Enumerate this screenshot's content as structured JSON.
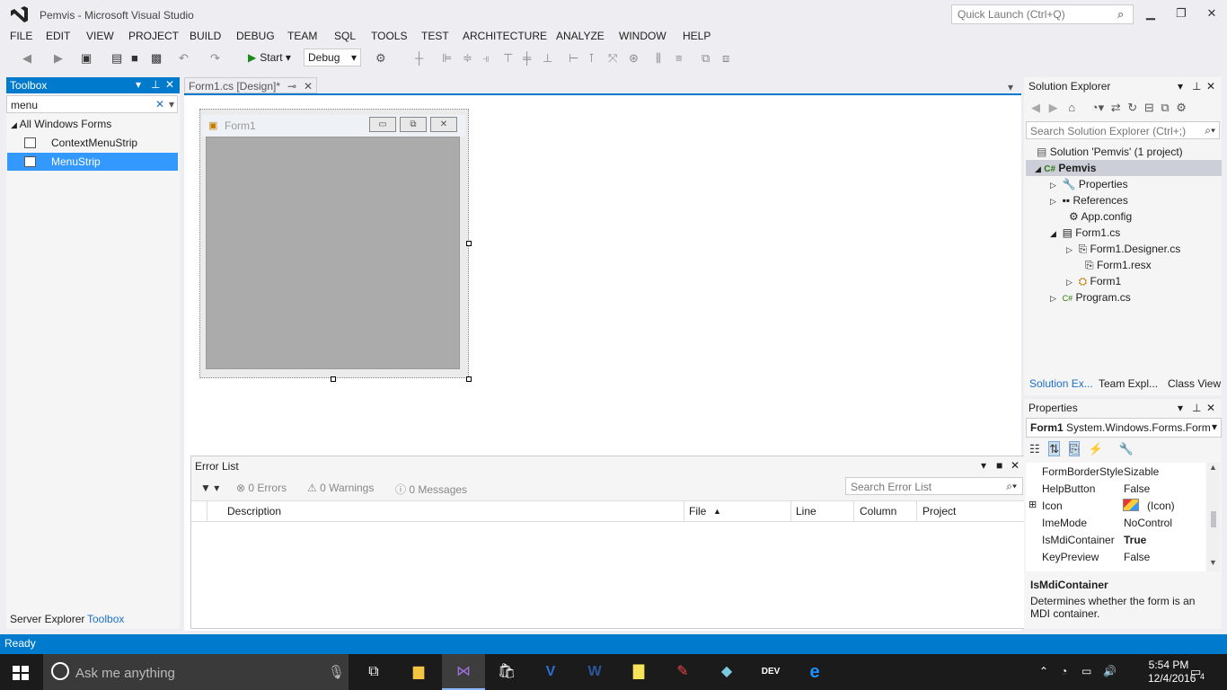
{
  "window": {
    "title": "Pemvis - Microsoft Visual Studio",
    "quick_launch_placeholder": "Quick Launch (Ctrl+Q)"
  },
  "menu": [
    "FILE",
    "EDIT",
    "VIEW",
    "PROJECT",
    "BUILD",
    "DEBUG",
    "TEAM",
    "SQL",
    "TOOLS",
    "TEST",
    "ARCHITECTURE",
    "ANALYZE",
    "WINDOW",
    "HELP"
  ],
  "toolbar": {
    "start_label": "Start",
    "config": "Debug"
  },
  "toolbox": {
    "title": "Toolbox",
    "search_value": "menu",
    "group": "All Windows Forms",
    "items": [
      "ContextMenuStrip",
      "MenuStrip"
    ],
    "tabs": [
      "Server Explorer",
      "Toolbox"
    ]
  },
  "document_tab": {
    "label": "Form1.cs [Design]*"
  },
  "form": {
    "title": "Form1"
  },
  "error_list": {
    "title": "Error List",
    "errors": "0 Errors",
    "warnings": "0 Warnings",
    "messages": "0 Messages",
    "search_placeholder": "Search Error List",
    "columns": [
      "Description",
      "File",
      "Line",
      "Column",
      "Project"
    ]
  },
  "solution_explorer": {
    "title": "Solution Explorer",
    "search_placeholder": "Search Solution Explorer (Ctrl+;)",
    "tree": [
      {
        "label": "Solution 'Pemvis' (1 project)"
      },
      {
        "label": "Pemvis"
      },
      {
        "label": "Properties"
      },
      {
        "label": "References"
      },
      {
        "label": "App.config"
      },
      {
        "label": "Form1.cs"
      },
      {
        "label": "Form1.Designer.cs"
      },
      {
        "label": "Form1.resx"
      },
      {
        "label": "Form1"
      },
      {
        "label": "Program.cs"
      }
    ],
    "tabs": [
      "Solution Ex...",
      "Team Expl...",
      "Class View"
    ]
  },
  "properties": {
    "title": "Properties",
    "object_name": "Form1",
    "object_type": "System.Windows.Forms.Form",
    "rows": [
      {
        "name": "FormBorderStyle",
        "value": "Sizable"
      },
      {
        "name": "HelpButton",
        "value": "False"
      },
      {
        "name": "Icon",
        "value": "(Icon)"
      },
      {
        "name": "ImeMode",
        "value": "NoControl"
      },
      {
        "name": "IsMdiContainer",
        "value": "True"
      },
      {
        "name": "KeyPreview",
        "value": "False"
      }
    ],
    "desc_title": "IsMdiContainer",
    "desc_text": "Determines whether the form is an MDI container."
  },
  "status": {
    "text": "Ready"
  },
  "taskbar": {
    "search_placeholder": "Ask me anything",
    "time": "5:54 PM",
    "date": "12/4/2016",
    "notifications": "4"
  },
  "colors": {
    "accent": "#007acc",
    "selection": "#3399ff"
  }
}
